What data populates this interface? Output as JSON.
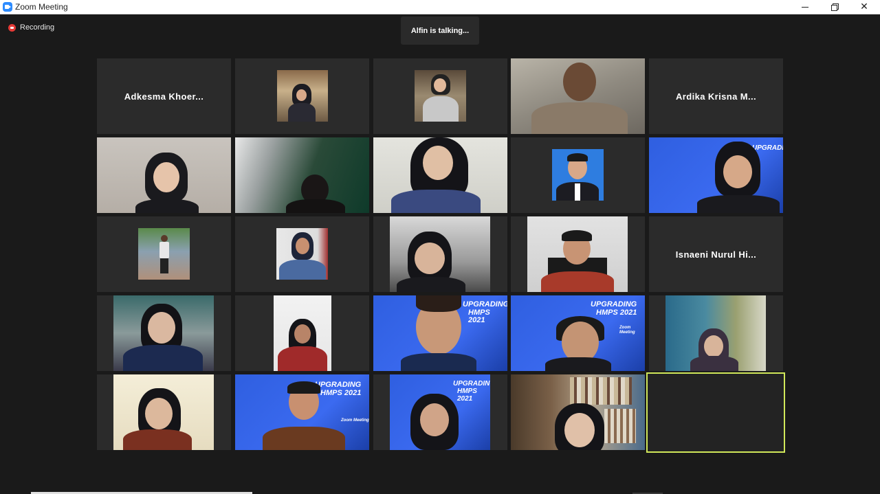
{
  "window": {
    "title": "Zoom Meeting",
    "minimize_icon": "minimize-icon",
    "maximize_icon": "restore-icon",
    "close_icon": "close-icon",
    "close_glyph": "✕"
  },
  "status": {
    "recording_label": "Recording",
    "speaker_indicator": "Alfin is talking..."
  },
  "colors": {
    "active_speaker_border": "#d1e85a",
    "recording_red": "#e53935",
    "tile_background": "#2b2b2b",
    "background": "#1a1a1a",
    "banner_blue": "#2f5fe0"
  },
  "gallery": {
    "name_tiles": [
      {
        "name": "Adkesma  Khoer..."
      },
      {
        "name": "Ardika  Krisna  M..."
      },
      {
        "name": "Isnaeni  Nurul  Hi..."
      }
    ],
    "banner": {
      "line1": "UPGRADING",
      "line2": "HMPS 2021",
      "sub": "Zoom Meeting"
    }
  }
}
